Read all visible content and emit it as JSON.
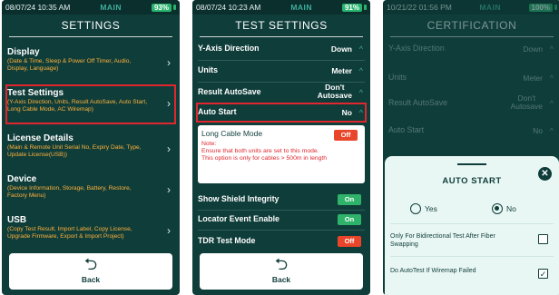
{
  "panel1": {
    "status": {
      "time": "08/07/24 10:35 AM",
      "mode": "MAIN",
      "battery": "93%"
    },
    "title": "SETTINGS",
    "items": [
      {
        "title": "Display",
        "sub": "(Date & Time, Sleep & Power Off Timer, Audio, Display, Language)"
      },
      {
        "title": "Test Settings",
        "sub": "(Y-Axis Direction, Units, Result AutoSave, Auto Start, Long Cable Mode, AC Wiremap)"
      },
      {
        "title": "License Details",
        "sub": "(Main & Remote Unit Serial No, Expiry Date, Type, Update License(USB))"
      },
      {
        "title": "Device",
        "sub": "(Device Information, Storage, Battery, Restore, Factory Menu)"
      },
      {
        "title": "USB",
        "sub": "(Copy Test Result, Import Label, Copy License, Upgrade Firmware, Export & Import Project)"
      }
    ],
    "back": "Back"
  },
  "panel2": {
    "status": {
      "time": "08/07/24 10:23 AM",
      "mode": "MAIN",
      "battery": "91%"
    },
    "title": "TEST SETTINGS",
    "rows": [
      {
        "label": "Y-Axis Direction",
        "value": "Down"
      },
      {
        "label": "Units",
        "value": "Meter"
      },
      {
        "label": "Result AutoSave",
        "value_line1": "Don't",
        "value_line2": "Autosave"
      },
      {
        "label": "Auto Start",
        "value": "No"
      }
    ],
    "long_cable": {
      "label": "Long Cable Mode",
      "state": "Off",
      "note_title": "Note:",
      "note_1": "Ensure that both units are set to this mode.",
      "note_2": "This option is only for cables > 500m in length"
    },
    "toggles": [
      {
        "label": "Show Shield Integrity",
        "state": "On"
      },
      {
        "label": "Locator Event Enable",
        "state": "On"
      },
      {
        "label": "TDR Test Mode",
        "state": "Off"
      }
    ],
    "back": "Back"
  },
  "panel3": {
    "status": {
      "time": "10/21/22 01:56 PM",
      "mode": "MAIN",
      "battery": "100%"
    },
    "title": "CERTIFICATION",
    "rows": [
      {
        "label": "Y-Axis Direction",
        "value": "Down"
      },
      {
        "label": "Units",
        "value": "Meter"
      },
      {
        "label": "Result AutoSave",
        "value_line1": "Don't",
        "value_line2": "Autosave"
      },
      {
        "label": "Auto Start",
        "value": "No"
      }
    ],
    "sheet": {
      "title": "AUTO START",
      "close": "✕",
      "options": [
        {
          "label": "Yes",
          "selected": false
        },
        {
          "label": "No",
          "selected": true
        }
      ],
      "checks": [
        {
          "label": "Only For Bidirectional Test After Fiber Swapping",
          "checked": false
        },
        {
          "label": "Do AutoTest If Wiremap Failed",
          "checked": true
        }
      ]
    }
  },
  "colors": {
    "bg": "#0f3d3a",
    "accent": "#3fae9b",
    "subtext": "#ffb13b",
    "highlight": "#e0262e",
    "on": "#2fb36a",
    "off": "#e8452a"
  }
}
